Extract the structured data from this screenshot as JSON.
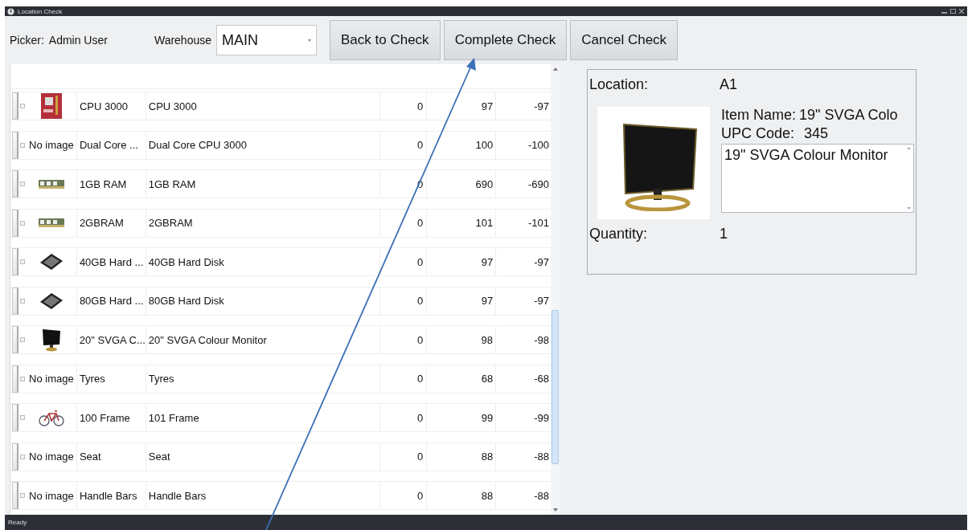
{
  "window": {
    "title": "Location Check"
  },
  "toolbar": {
    "picker_label": "Picker:",
    "picker_value": "Admin User",
    "warehouse_label": "Warehouse",
    "warehouse_value": "MAIN",
    "buttons": [
      "Back to Check",
      "Complete Check",
      "Cancel Check"
    ]
  },
  "rows": [
    {
      "image": {
        "kind": "board"
      },
      "code": "CPU 3000",
      "name": "CPU 3000",
      "column_4": "0",
      "column_5": "97",
      "column_6": "-97"
    },
    {
      "image": {
        "kind": "none",
        "text": "No image"
      },
      "code": "Dual Core ...",
      "name": "Dual Core CPU 3000",
      "column_4": "0",
      "column_5": "100",
      "column_6": "-100"
    },
    {
      "image": {
        "kind": "ram"
      },
      "code": "1GB RAM",
      "name": "1GB RAM",
      "column_4": "0",
      "column_5": "690",
      "column_6": "-690"
    },
    {
      "image": {
        "kind": "ram"
      },
      "code": "2GBRAM",
      "name": "2GBRAM",
      "column_4": "0",
      "column_5": "101",
      "column_6": "-101"
    },
    {
      "image": {
        "kind": "disk"
      },
      "code": "40GB Hard ...",
      "name": "40GB Hard Disk",
      "column_4": "0",
      "column_5": "97",
      "column_6": "-97"
    },
    {
      "image": {
        "kind": "disk"
      },
      "code": "80GB Hard ...",
      "name": "80GB Hard Disk",
      "column_4": "0",
      "column_5": "97",
      "column_6": "-97"
    },
    {
      "image": {
        "kind": "monitor"
      },
      "code": "20\" SVGA C...",
      "name": "20\" SVGA Colour Monitor",
      "column_4": "0",
      "column_5": "98",
      "column_6": "-98"
    },
    {
      "image": {
        "kind": "none",
        "text": "No image"
      },
      "code": "Tyres",
      "name": "Tyres",
      "column_4": "0",
      "column_5": "68",
      "column_6": "-68"
    },
    {
      "image": {
        "kind": "bike"
      },
      "code": "100 Frame",
      "name": "101 Frame",
      "column_4": "0",
      "column_5": "99",
      "column_6": "-99"
    },
    {
      "image": {
        "kind": "none",
        "text": "No image"
      },
      "code": "Seat",
      "name": "Seat",
      "column_4": "0",
      "column_5": "88",
      "column_6": "-88"
    },
    {
      "image": {
        "kind": "none",
        "text": "No image"
      },
      "code": "Handle Bars",
      "name": "Handle Bars",
      "column_4": "0",
      "column_5": "88",
      "column_6": "-88"
    }
  ],
  "details": {
    "location_label": "Location:",
    "location_value": "A1",
    "item_name_label": "Item Name:",
    "item_name_value": "19\" SVGA Colo",
    "upc_label": "UPC Code:",
    "upc_value": "345",
    "description": "19\" SVGA Colour Monitor",
    "quantity_label": "Quantity:",
    "quantity_value": "1"
  },
  "status_bar": {
    "text": "Ready"
  }
}
